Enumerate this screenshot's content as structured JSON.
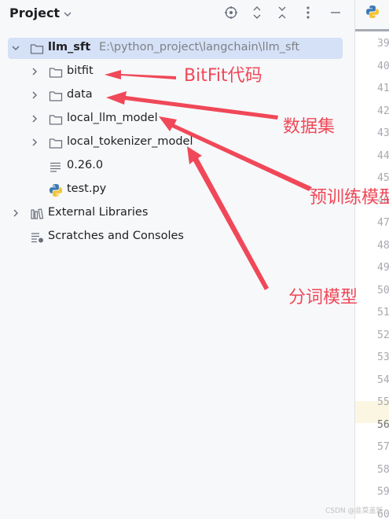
{
  "panel": {
    "title": "Project"
  },
  "tree": {
    "root": {
      "name": "llm_sft",
      "path": "E:\\python_project\\langchain\\llm_sft"
    },
    "items": [
      {
        "label": "bitfit"
      },
      {
        "label": "data"
      },
      {
        "label": "local_llm_model"
      },
      {
        "label": "local_tokenizer_model"
      },
      {
        "label": "0.26.0"
      },
      {
        "label": "test.py"
      },
      {
        "label": "External Libraries"
      },
      {
        "label": "Scratches and Consoles"
      }
    ]
  },
  "editor": {
    "line_numbers": [
      "39",
      "40",
      "41",
      "42",
      "43",
      "44",
      "45",
      "46",
      "47",
      "48",
      "49",
      "50",
      "51",
      "52",
      "53",
      "54",
      "55",
      "56",
      "57",
      "58",
      "59",
      "60"
    ],
    "current_line": "56"
  },
  "annotations": {
    "bitfit": "BitFit代码",
    "data": "数据集",
    "llm_model": "预训练模型",
    "tokenizer": "分词模型",
    "color": "#f04858"
  },
  "watermark": "CSDN @韭菜盖饭"
}
